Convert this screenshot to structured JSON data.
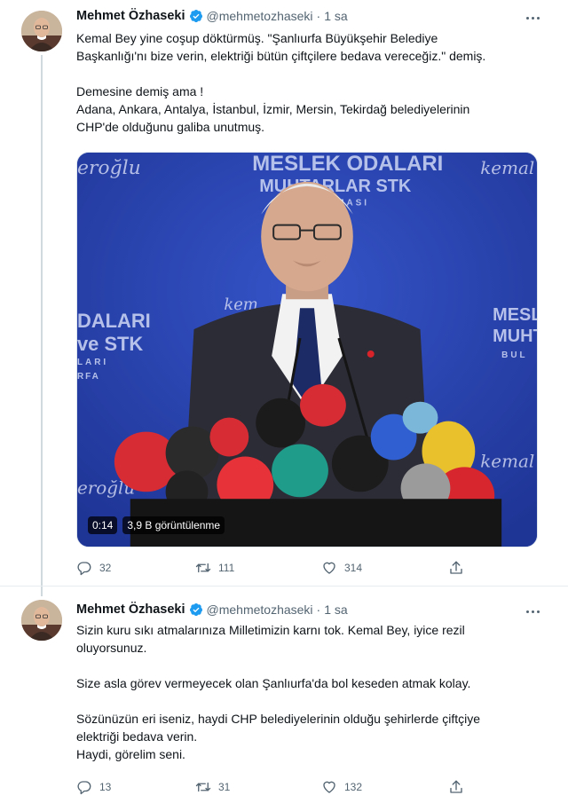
{
  "colors": {
    "text": "#0f1419",
    "secondary": "#536471",
    "verified": "#1d9bf0",
    "thread_line": "#cfd9de",
    "video_bg": "#2c47b8"
  },
  "tweets": [
    {
      "author": {
        "name": "Mehmet Özhaseki",
        "handle": "@mehmetozhaseki",
        "separator": "·",
        "time": "1 sa",
        "verified_icon": "verified-badge-icon"
      },
      "lines": [
        "Kemal Bey yine coşup döktürmüş. \"Şanlıurfa Büyükşehir Belediye",
        "Başkanlığı'nı bize verin, elektriği bütün çiftçilere bedava vereceğiz.\" demiş.",
        "",
        "Demesine demiş ama !",
        "Adana, Ankara, Antalya, İstanbul, İzmir, Mersin, Tekirdağ belediyelerinin",
        "CHP'de olduğunu galiba unutmuş."
      ],
      "media": {
        "duration": "0:14",
        "views": "3,9 B görüntülenme",
        "backdrop_text": {
          "top": "MESLEK ODALARI",
          "top2": "MUHTARLAR STK",
          "top3": "BULUŞMASI",
          "left": "eroğlu",
          "left2": "DALARI",
          "left3": "ve STK",
          "left4": "LARI",
          "left5": "RFA",
          "left6": "eroğlu",
          "right": "kemal",
          "right2": "MESL",
          "right3": "MUHT",
          "right4": "BUL",
          "right5": "kemal",
          "center": "kem"
        }
      },
      "stats": {
        "replies": "32",
        "retweets": "111",
        "likes": "314"
      }
    },
    {
      "author": {
        "name": "Mehmet Özhaseki",
        "handle": "@mehmetozhaseki",
        "separator": "·",
        "time": "1 sa",
        "verified_icon": "verified-badge-icon"
      },
      "lines": [
        "Sizin kuru sıkı atmalarınıza Milletimizin karnı tok. Kemal Bey, iyice rezil",
        "oluyorsunuz.",
        "",
        "Size asla görev vermeyecek olan Şanlıurfa'da bol keseden atmak kolay.",
        "",
        "Sözünüzün eri iseniz, haydi CHP belediyelerinin olduğu şehirlerde çiftçiye",
        "elektriği bedava verin.",
        "Haydi, görelim seni."
      ],
      "stats": {
        "replies": "13",
        "retweets": "31",
        "likes": "132"
      }
    }
  ]
}
